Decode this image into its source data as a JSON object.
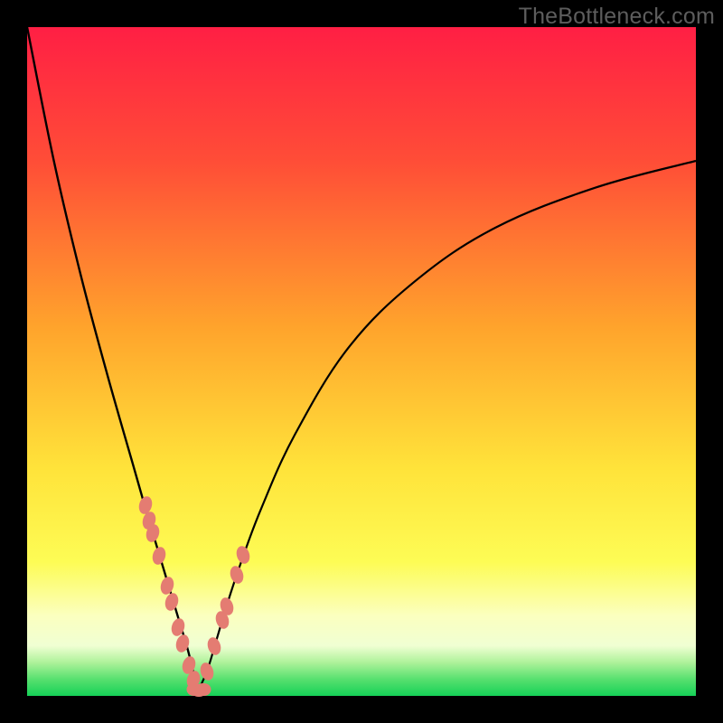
{
  "watermark": "TheBottleneck.com",
  "colors": {
    "page_bg": "#000000",
    "gradient_top": "#ff1f44",
    "gradient_mid_upper": "#ff6a2e",
    "gradient_mid": "#ffc229",
    "gradient_mid_lower": "#fff646",
    "gradient_pale": "#f9ffbb",
    "gradient_green_pale": "#9cf08a",
    "gradient_green": "#15d157",
    "marker": "#e47c72",
    "curve": "#000000"
  },
  "chart_data": {
    "type": "line",
    "title": "",
    "xlabel": "",
    "ylabel": "",
    "xlim": [
      0,
      100
    ],
    "ylim": [
      0,
      100
    ],
    "grid": false,
    "curve_left": {
      "x": [
        0,
        4,
        8,
        12,
        16,
        18,
        19.5,
        21,
        22.5,
        24,
        25,
        25.7
      ],
      "y": [
        100,
        80,
        63,
        48,
        34,
        27,
        22,
        17,
        12,
        7,
        3,
        1
      ]
    },
    "curve_right": {
      "x": [
        25.7,
        27,
        28.5,
        30,
        32,
        35,
        40,
        48,
        58,
        70,
        85,
        100
      ],
      "y": [
        1,
        4,
        9,
        14,
        20,
        28,
        39,
        52,
        62,
        70,
        76,
        80
      ]
    },
    "series_left_highlight": {
      "name": "left-markers",
      "x": [
        17.7,
        18.3,
        18.8,
        19.7,
        20.9,
        21.6,
        22.6,
        23.3,
        24.2,
        24.9
      ],
      "y": [
        28.5,
        26.2,
        24.3,
        21.0,
        16.5,
        14.0,
        10.3,
        7.9,
        4.6,
        2.5
      ]
    },
    "series_right_highlight": {
      "name": "right-markers",
      "x": [
        26.9,
        28.0,
        29.2,
        29.8,
        31.3,
        32.3
      ],
      "y": [
        3.7,
        7.4,
        11.4,
        13.4,
        18.1,
        21.1
      ]
    },
    "series_bottom": {
      "name": "bottom-markers",
      "x": [
        25.0,
        25.7,
        26.4
      ],
      "y": [
        0.9,
        0.8,
        0.9
      ]
    }
  }
}
